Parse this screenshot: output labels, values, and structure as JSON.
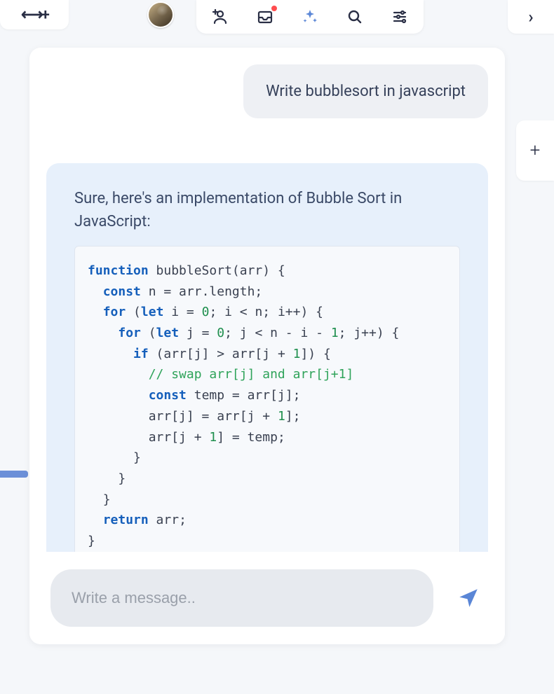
{
  "toolbar": {
    "expand_collapse_glyph": "↔+"
  },
  "right_rail": {
    "add_label": "+"
  },
  "conversation": {
    "user_message": "Write bubblesort in javascript",
    "assistant_intro": "Sure, here's an implementation of Bubble Sort in JavaScript:",
    "code": {
      "l1a": "function",
      "l1b": " bubbleSort(arr) {",
      "l2a": "const",
      "l2b": " n = arr.length;",
      "l3a": "for",
      "l3b": " (",
      "l3c": "let",
      "l3d": " i = ",
      "l3e": "0",
      "l3f": "; i < n; i++) {",
      "l4a": "for",
      "l4b": " (",
      "l4c": "let",
      "l4d": " j = ",
      "l4e": "0",
      "l4f": "; j < n - i - ",
      "l4g": "1",
      "l4h": "; j++) {",
      "l5a": "if",
      "l5b": " (arr[j] > arr[j + ",
      "l5c": "1",
      "l5d": "]) {",
      "l6": "// swap arr[j] and arr[j+1]",
      "l7a": "const",
      "l7b": " temp = arr[j];",
      "l8a": "arr[j] = arr[j + ",
      "l8b": "1",
      "l8c": "];",
      "l9a": "arr[j + ",
      "l9b": "1",
      "l9c": "] = temp;",
      "l10": "}",
      "l11": "}",
      "l12": "}",
      "l13a": "return",
      "l13b": " arr;",
      "l14": "}"
    }
  },
  "composer": {
    "placeholder": "Write a message..",
    "value": ""
  }
}
